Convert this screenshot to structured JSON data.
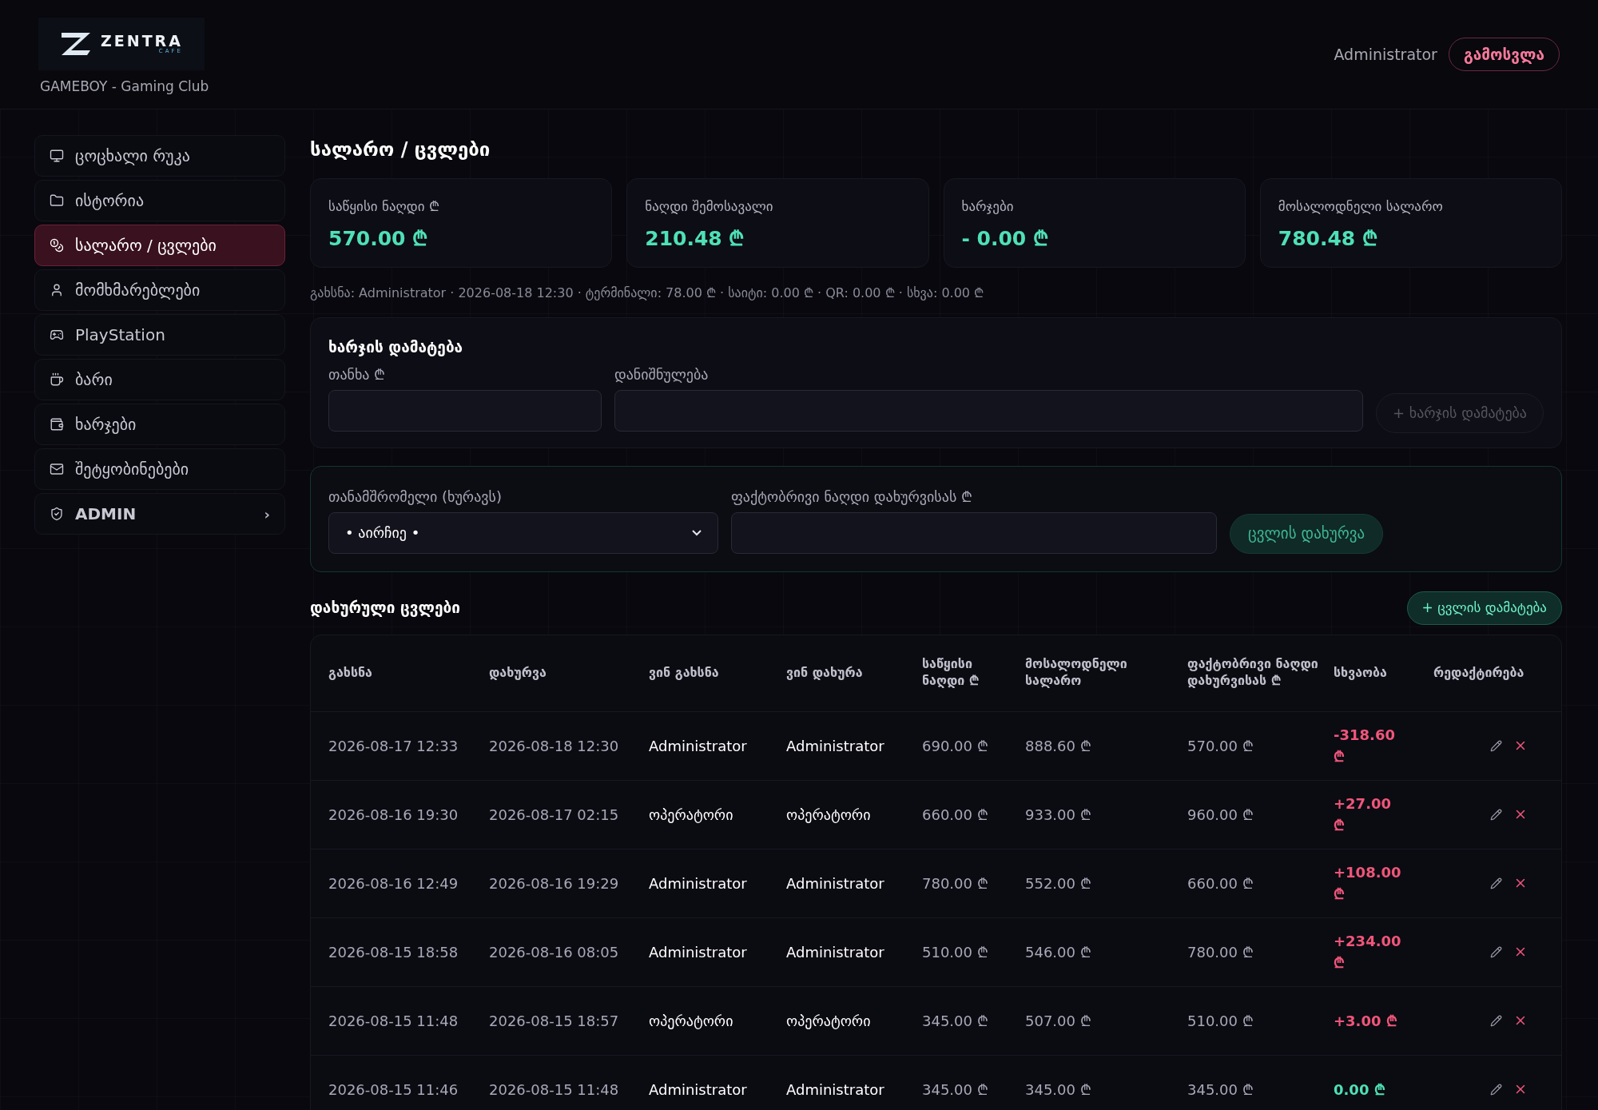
{
  "header": {
    "logo": {
      "word": "ZENTRA",
      "sub": "CAFE"
    },
    "club": "GAMEBOY - Gaming Club",
    "user": "Administrator",
    "logout": "გამოსვლა"
  },
  "sidebar": {
    "items": [
      {
        "label": "ცოცხალი რუკა",
        "selected": false,
        "kind": "link"
      },
      {
        "label": "ისტორია",
        "selected": false,
        "kind": "link"
      },
      {
        "label": "სალარო / ცვლები",
        "selected": true,
        "kind": "link"
      },
      {
        "label": "მომხმარებლები",
        "selected": false,
        "kind": "link"
      },
      {
        "label": "PlayStation",
        "selected": false,
        "kind": "link"
      },
      {
        "label": "ბარი",
        "selected": false,
        "kind": "link"
      },
      {
        "label": "ხარჯები",
        "selected": false,
        "kind": "link"
      },
      {
        "label": "შეტყობინებები",
        "selected": false,
        "kind": "link"
      },
      {
        "label": "ADMIN",
        "selected": false,
        "kind": "group",
        "chevron": "›"
      }
    ]
  },
  "page_title": "სალარო / ცვლები",
  "stats": [
    {
      "label": "საწყისი ნაღდი ₾",
      "value": "570.00 ₾"
    },
    {
      "label": "ნაღდი შემოსავალი",
      "value": "210.48 ₾"
    },
    {
      "label": "ხარჯები",
      "value": "- 0.00 ₾"
    },
    {
      "label": "მოსალოდნელი სალარო",
      "value": "780.48 ₾"
    }
  ],
  "info_line": "გახსნა: Administrator · 2026-08-18 12:30 · ტერმინალი: 78.00 ₾ · საიტი: 0.00 ₾ · QR: 0.00 ₾ · სხვა: 0.00 ₾",
  "expense_form": {
    "title": "ხარჯის დამატება",
    "amount_label": "თანხა ₾",
    "purpose_label": "დანიშნულება",
    "button": "+ ხარჯის დამატება",
    "button_disabled": true
  },
  "close_shift": {
    "employee_label": "თანამშრომელი (ხურავს)",
    "employee_value": "• აირჩიე •",
    "cash_label": "ფაქტობრივი ნაღდი დახურვისას ₾",
    "button": "ცვლის დახურვა"
  },
  "closed_shifts": {
    "title": "დახურული ცვლები",
    "add_button": "+ ცვლის დამატება",
    "columns": [
      "გახსნა",
      "დახურვა",
      "ვინ გახსნა",
      "ვინ დახურა",
      "საწყისი ნაღდი ₾",
      "მოსალოდნელი სალარო",
      "ფაქტობრივი ნაღდი დახურვისას ₾",
      "სხვაობა",
      "რედაქტირება"
    ],
    "rows": [
      {
        "opened": "2026-08-17 12:33",
        "closed": "2026-08-18 12:30",
        "opened_by": "Administrator",
        "closed_by": "Administrator",
        "start": "690.00 ₾",
        "expected": "888.60 ₾",
        "actual": "570.00 ₾",
        "diff": "-318.60 ₾",
        "color": "#f0567a"
      },
      {
        "opened": "2026-08-16 19:30",
        "closed": "2026-08-17 02:15",
        "opened_by": "ოპერატორი",
        "closed_by": "ოპერატორი",
        "start": "660.00 ₾",
        "expected": "933.00 ₾",
        "actual": "960.00 ₾",
        "diff": "+27.00 ₾",
        "color": "#f0567a"
      },
      {
        "opened": "2026-08-16 12:49",
        "closed": "2026-08-16 19:29",
        "opened_by": "Administrator",
        "closed_by": "Administrator",
        "start": "780.00 ₾",
        "expected": "552.00 ₾",
        "actual": "660.00 ₾",
        "diff": "+108.00 ₾",
        "color": "#f0567a"
      },
      {
        "opened": "2026-08-15 18:58",
        "closed": "2026-08-16 08:05",
        "opened_by": "Administrator",
        "closed_by": "Administrator",
        "start": "510.00 ₾",
        "expected": "546.00 ₾",
        "actual": "780.00 ₾",
        "diff": "+234.00 ₾",
        "color": "#f0567a"
      },
      {
        "opened": "2026-08-15 11:48",
        "closed": "2026-08-15 18:57",
        "opened_by": "ოპერატორი",
        "closed_by": "ოპერატორი",
        "start": "345.00 ₾",
        "expected": "507.00 ₾",
        "actual": "510.00 ₾",
        "diff": "+3.00 ₾",
        "color": "#f0567a"
      },
      {
        "opened": "2026-08-15 11:46",
        "closed": "2026-08-15 11:48",
        "opened_by": "Administrator",
        "closed_by": "Administrator",
        "start": "345.00 ₾",
        "expected": "345.00 ₾",
        "actual": "345.00 ₾",
        "diff": "0.00 ₾",
        "color": "#4fe0b6"
      }
    ]
  }
}
